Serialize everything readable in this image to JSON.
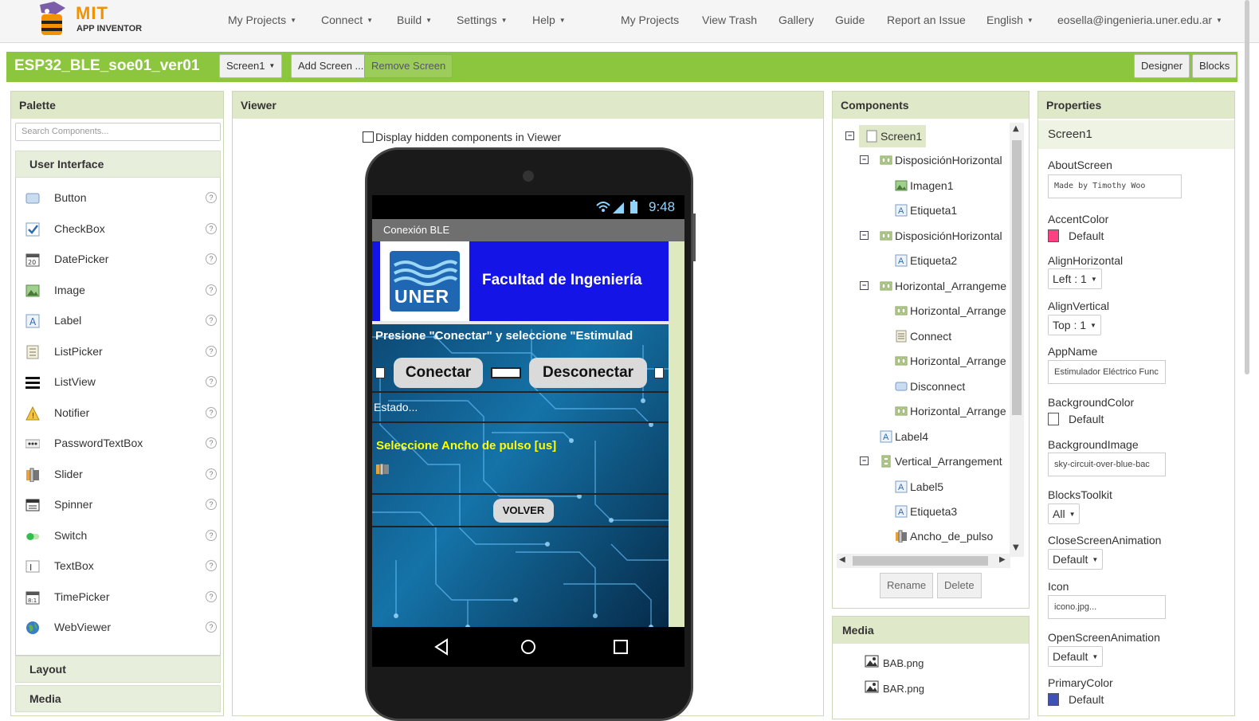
{
  "topnav": {
    "logo_main": "MIT",
    "logo_sub": "APP INVENTOR",
    "menus": [
      "My Projects",
      "Connect",
      "Build",
      "Settings",
      "Help"
    ],
    "links": [
      "My Projects",
      "View Trash",
      "Gallery",
      "Guide",
      "Report an Issue"
    ],
    "language": "English",
    "user": "eosella@ingenieria.uner.edu.ar"
  },
  "projectbar": {
    "project_name": "ESP32_BLE_soe01_ver01",
    "screen_select": "Screen1",
    "add_screen": "Add Screen ...",
    "remove_screen": "Remove Screen",
    "designer": "Designer",
    "blocks": "Blocks"
  },
  "palette": {
    "title": "Palette",
    "search_placeholder": "Search Components...",
    "categories": [
      "User Interface",
      "Layout",
      "Media"
    ],
    "items": [
      {
        "label": "Button",
        "icon": "button-icon"
      },
      {
        "label": "CheckBox",
        "icon": "checkbox-icon"
      },
      {
        "label": "DatePicker",
        "icon": "datepicker-icon"
      },
      {
        "label": "Image",
        "icon": "image-icon"
      },
      {
        "label": "Label",
        "icon": "label-icon"
      },
      {
        "label": "ListPicker",
        "icon": "listpicker-icon"
      },
      {
        "label": "ListView",
        "icon": "listview-icon"
      },
      {
        "label": "Notifier",
        "icon": "notifier-icon"
      },
      {
        "label": "PasswordTextBox",
        "icon": "password-icon"
      },
      {
        "label": "Slider",
        "icon": "slider-icon"
      },
      {
        "label": "Spinner",
        "icon": "spinner-icon"
      },
      {
        "label": "Switch",
        "icon": "switch-icon"
      },
      {
        "label": "TextBox",
        "icon": "textbox-icon"
      },
      {
        "label": "TimePicker",
        "icon": "timepicker-icon"
      },
      {
        "label": "WebViewer",
        "icon": "webviewer-icon"
      }
    ],
    "help": "?"
  },
  "viewer": {
    "title": "Viewer",
    "hidden_checkbox_label": "Display hidden components in Viewer",
    "phone": {
      "time": "9:48",
      "screen_title": "Conexión BLE",
      "logo_text": "UNER",
      "header": "Facultad de Ingeniería",
      "instruction": "Presione \"Conectar\" y seleccione \"Estimulad",
      "connect": "Conectar",
      "disconnect": "Desconectar",
      "status": "Estado...",
      "pulse_label": "Seleccione Ancho de pulso [us]",
      "back": "VOLVER"
    }
  },
  "components": {
    "title": "Components",
    "tree": [
      {
        "label": "Screen1",
        "depth": 0,
        "expander": true,
        "selected": true
      },
      {
        "label": "DisposiciónHorizontal",
        "depth": 1,
        "expander": true
      },
      {
        "label": "Imagen1",
        "depth": 2
      },
      {
        "label": "Etiqueta1",
        "depth": 2
      },
      {
        "label": "DisposiciónHorizontal",
        "depth": 1,
        "expander": true
      },
      {
        "label": "Etiqueta2",
        "depth": 2
      },
      {
        "label": "Horizontal_Arrangeme",
        "depth": 1,
        "expander": true
      },
      {
        "label": "Horizontal_Arrange",
        "depth": 2
      },
      {
        "label": "Connect",
        "depth": 2
      },
      {
        "label": "Horizontal_Arrange",
        "depth": 2
      },
      {
        "label": "Disconnect",
        "depth": 2
      },
      {
        "label": "Horizontal_Arrange",
        "depth": 2
      },
      {
        "label": "Label4",
        "depth": 1
      },
      {
        "label": "Vertical_Arrangement",
        "depth": 1,
        "expander": true
      },
      {
        "label": "Label5",
        "depth": 2
      },
      {
        "label": "Etiqueta3",
        "depth": 2
      },
      {
        "label": "Ancho_de_pulso",
        "depth": 2
      }
    ],
    "rename": "Rename",
    "delete": "Delete"
  },
  "media": {
    "title": "Media",
    "files": [
      "BAB.png",
      "BAR.png"
    ]
  },
  "properties": {
    "title": "Properties",
    "component": "Screen1",
    "about_label": "AboutScreen",
    "about_value": "Made by Timothy Woo",
    "accent_label": "AccentColor",
    "accent_value": "Default",
    "accent_color": "#ff4081",
    "alignh_label": "AlignHorizontal",
    "alignh_value": "Left : 1",
    "alignv_label": "AlignVertical",
    "alignv_value": "Top : 1",
    "appname_label": "AppName",
    "appname_value": "Estimulador Eléctrico Func",
    "bgcolor_label": "BackgroundColor",
    "bgcolor_value": "Default",
    "bgimage_label": "BackgroundImage",
    "bgimage_value": "sky-circuit-over-blue-bac",
    "toolkit_label": "BlocksToolkit",
    "toolkit_value": "All",
    "closeanim_label": "CloseScreenAnimation",
    "closeanim_value": "Default",
    "icon_label": "Icon",
    "icon_value": "icono.jpg...",
    "openanim_label": "OpenScreenAnimation",
    "openanim_value": "Default",
    "primary_label": "PrimaryColor",
    "primary_value": "Default",
    "primary_color": "#3f51b5"
  }
}
